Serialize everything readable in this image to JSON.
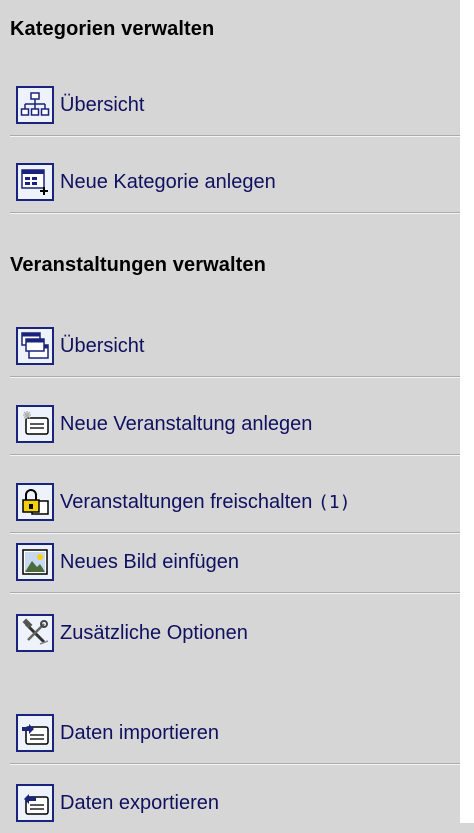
{
  "categories": {
    "title": "Kategorien verwalten",
    "items": [
      {
        "label": "Übersicht",
        "icon": "tree-structure-icon"
      },
      {
        "label": "Neue Kategorie anlegen",
        "icon": "new-window-icon"
      }
    ]
  },
  "events": {
    "title": "Veranstaltungen verwalten",
    "items": [
      {
        "label": "Übersicht",
        "icon": "stacked-windows-icon"
      },
      {
        "label": "Neue Veranstaltung anlegen",
        "icon": "new-card-icon"
      },
      {
        "label": "Veranstaltungen freischalten",
        "count": "(1)",
        "icon": "lock-icon"
      },
      {
        "label": "Neues Bild einfügen",
        "icon": "picture-icon"
      },
      {
        "label": "Zusätzliche Optionen",
        "icon": "tools-icon"
      },
      {
        "label": "Daten importieren",
        "icon": "import-icon"
      },
      {
        "label": "Daten exportieren",
        "icon": "export-icon"
      }
    ]
  }
}
